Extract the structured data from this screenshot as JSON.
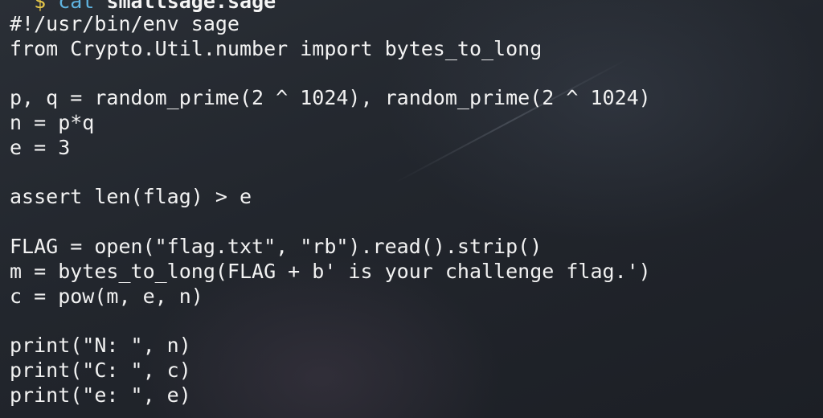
{
  "terminal": {
    "prompt": {
      "symbol": "$",
      "command": "cat",
      "argument": "smallsage.sage"
    },
    "lines": [
      "#!/usr/bin/env sage",
      "from Crypto.Util.number import bytes_to_long",
      "",
      "p, q = random_prime(2 ^ 1024), random_prime(2 ^ 1024)",
      "n = p*q",
      "e = 3",
      "",
      "assert len(flag) > e",
      "",
      "FLAG = open(\"flag.txt\", \"rb\").read().strip()",
      "m = bytes_to_long(FLAG + b' is your challenge flag.')",
      "c = pow(m, e, n)",
      "",
      "print(\"N: \", n)",
      "print(\"C: \", c)",
      "print(\"e: \", e)"
    ]
  }
}
